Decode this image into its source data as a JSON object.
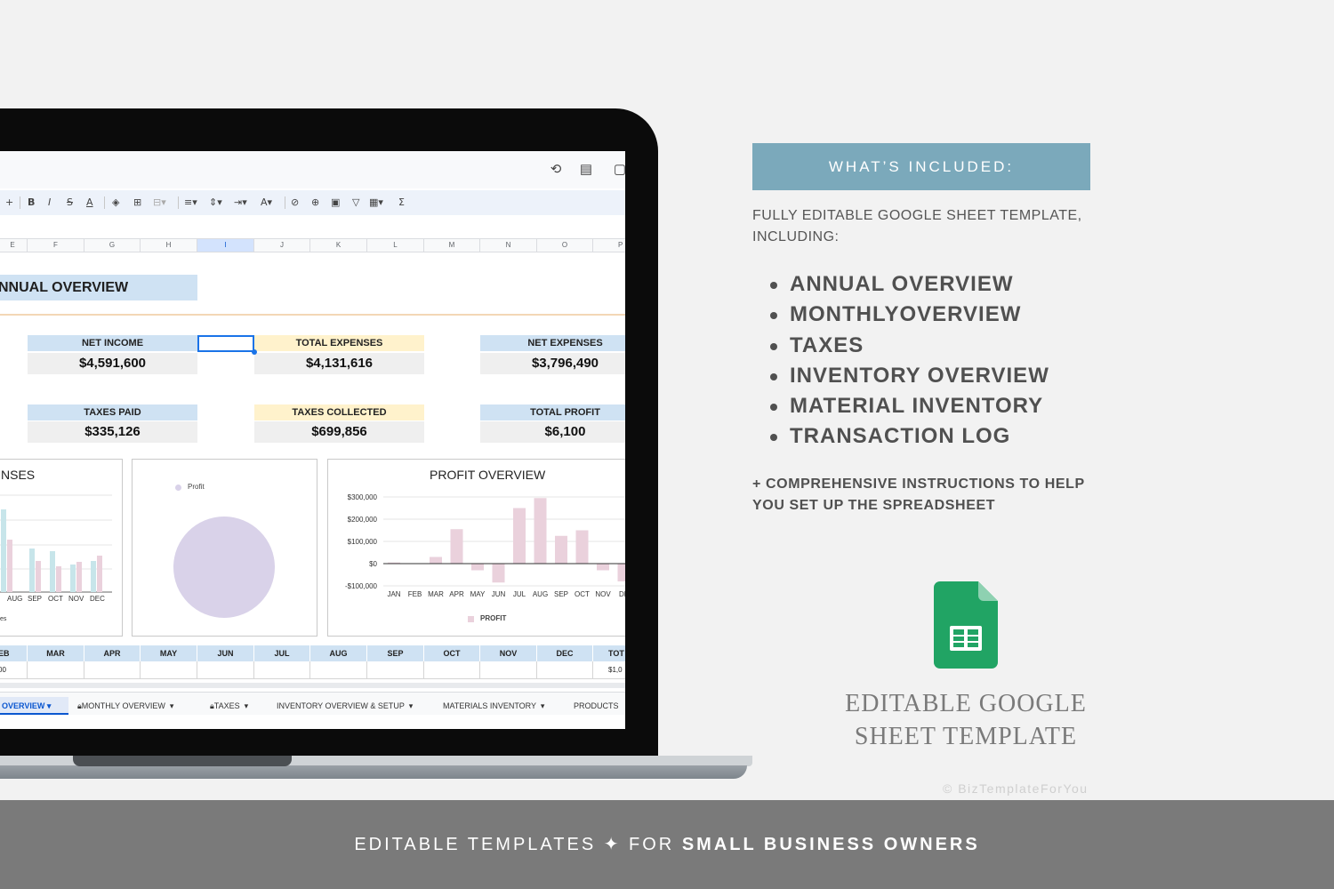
{
  "screen": {
    "column_letters": [
      "E",
      "F",
      "G",
      "H",
      "I",
      "J",
      "K",
      "L",
      "M",
      "N",
      "O",
      "P"
    ],
    "title": "NNUAL OVERVIEW",
    "kpis": [
      {
        "label": "NET INCOME",
        "value": "$4,591,600",
        "color": "#cfe2f3"
      },
      {
        "label": "TOTAL EXPENSES",
        "value": "$4,131,616",
        "color": "#fff2cc"
      },
      {
        "label": "NET EXPENSES",
        "value": "$3,796,490",
        "color": "#cfe2f3"
      },
      {
        "label": "TAXES PAID",
        "value": "$335,126",
        "color": "#cfe2f3"
      },
      {
        "label": "TAXES COLLECTED",
        "value": "$699,856",
        "color": "#fff2cc"
      },
      {
        "label": "TOTAL PROFIT",
        "value": "$6,100",
        "color": "#cfe2f3"
      }
    ],
    "expenses_chart": {
      "title_fragment": "NSES",
      "months": [
        "AUG",
        "SEP",
        "OCT",
        "NOV",
        "DEC"
      ],
      "legend_fragment": "es"
    },
    "pie_chart": {
      "legend": "Profit",
      "color": "#d9d2e9"
    },
    "data_header": [
      "EB",
      "MAR",
      "APR",
      "MAY",
      "JUN",
      "JUL",
      "AUG",
      "SEP",
      "OCT",
      "NOV",
      "DEC",
      "TOT"
    ],
    "data_row_first": "00",
    "data_row_last": "$1,0",
    "sheet_tabs": {
      "active": "OVERVIEW",
      "monthly": "MONTHLY OVERVIEW",
      "taxes": "TAXES",
      "inventory": "INVENTORY OVERVIEW & SETUP",
      "materials": "MATERIALS INVENTORY",
      "products": "PRODUCTS"
    }
  },
  "chart_data": {
    "type": "bar",
    "title": "PROFIT OVERVIEW",
    "categories": [
      "JAN",
      "FEB",
      "MAR",
      "APR",
      "MAY",
      "JUN",
      "JUL",
      "AUG",
      "SEP",
      "OCT",
      "NOV",
      "DE"
    ],
    "series": [
      {
        "name": "PROFIT",
        "values": [
          5000,
          2000,
          30000,
          155000,
          -30000,
          -85000,
          250000,
          295000,
          125000,
          150000,
          -30000,
          -80000
        ]
      }
    ],
    "ylim": [
      -100000,
      300000
    ],
    "yticks": [
      "$300,000",
      "$200,000",
      "$100,000",
      "$0",
      "-$100,000"
    ],
    "xlabel": "",
    "ylabel": "",
    "legend": "bottom",
    "color": "#ead1dc"
  },
  "panel": {
    "banner": "WHAT’S INCLUDED:",
    "intro": "FULLY EDITABLE GOOGLE SHEET TEMPLATE, INCLUDING:",
    "features": [
      "ANNUAL OVERVIEW",
      "MONTHLYOVERVIEW",
      "TAXES",
      "INVENTORY OVERVIEW",
      "MATERIAL INVENTORY",
      "TRANSACTION LOG"
    ],
    "extra": "+ COMPREHENSIVE INSTRUCTIONS TO HELP YOU SET UP THE SPREADSHEET",
    "editable_title": "EDITABLE GOOGLE SHEET TEMPLATE",
    "copyright": "© BizTemplateForYou"
  },
  "footer": {
    "left": "EDITABLE TEMPLATES ✦ FOR ",
    "bold": "SMALL BUSINESS OWNERS"
  },
  "colors": {
    "banner": "#7ba9bb",
    "footer": "#7a7a7a",
    "sheets_green": "#21a464"
  }
}
